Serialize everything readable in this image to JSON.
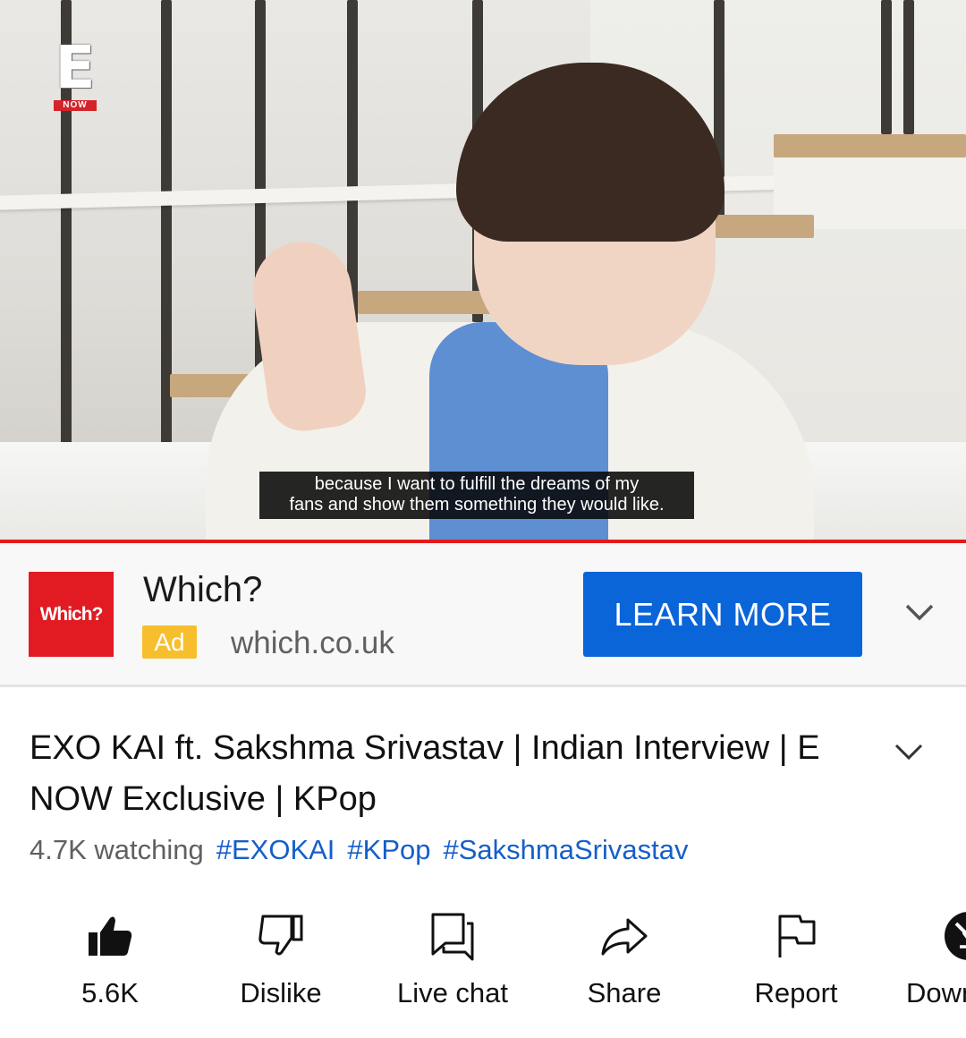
{
  "player": {
    "brand_letter": "E",
    "brand_now": "NOW",
    "caption_line1": "because I want to fulfill the dreams of my",
    "caption_line2": "fans and show them something they would like.",
    "progress_color": "#e51a1a"
  },
  "ad": {
    "logo_text": "Which?",
    "title": "Which?",
    "badge": "Ad",
    "domain": "which.co.uk",
    "cta_label": "LEARN MORE",
    "expand_icon": "chevron-down-icon",
    "cta_color": "#0a65d9",
    "badge_color": "#f7bf2e",
    "logo_color": "#e21a22"
  },
  "video": {
    "title": "EXO KAI ft. Sakshma Srivastav | Indian Interview | E NOW Exclusive | KPop",
    "watching": "4.7K watching",
    "hashtags": [
      "#EXOKAI",
      "#KPop",
      "#SakshmaSrivastav"
    ],
    "expand_icon": "chevron-down-icon",
    "hashtag_color": "#155fc9"
  },
  "actions": [
    {
      "label": "5.6K",
      "icon": "thumbs-up-icon"
    },
    {
      "label": "Dislike",
      "icon": "thumbs-down-icon"
    },
    {
      "label": "Live chat",
      "icon": "chat-icon"
    },
    {
      "label": "Share",
      "icon": "share-icon"
    },
    {
      "label": "Report",
      "icon": "flag-icon"
    },
    {
      "label": "Download",
      "icon": "download-icon"
    }
  ]
}
